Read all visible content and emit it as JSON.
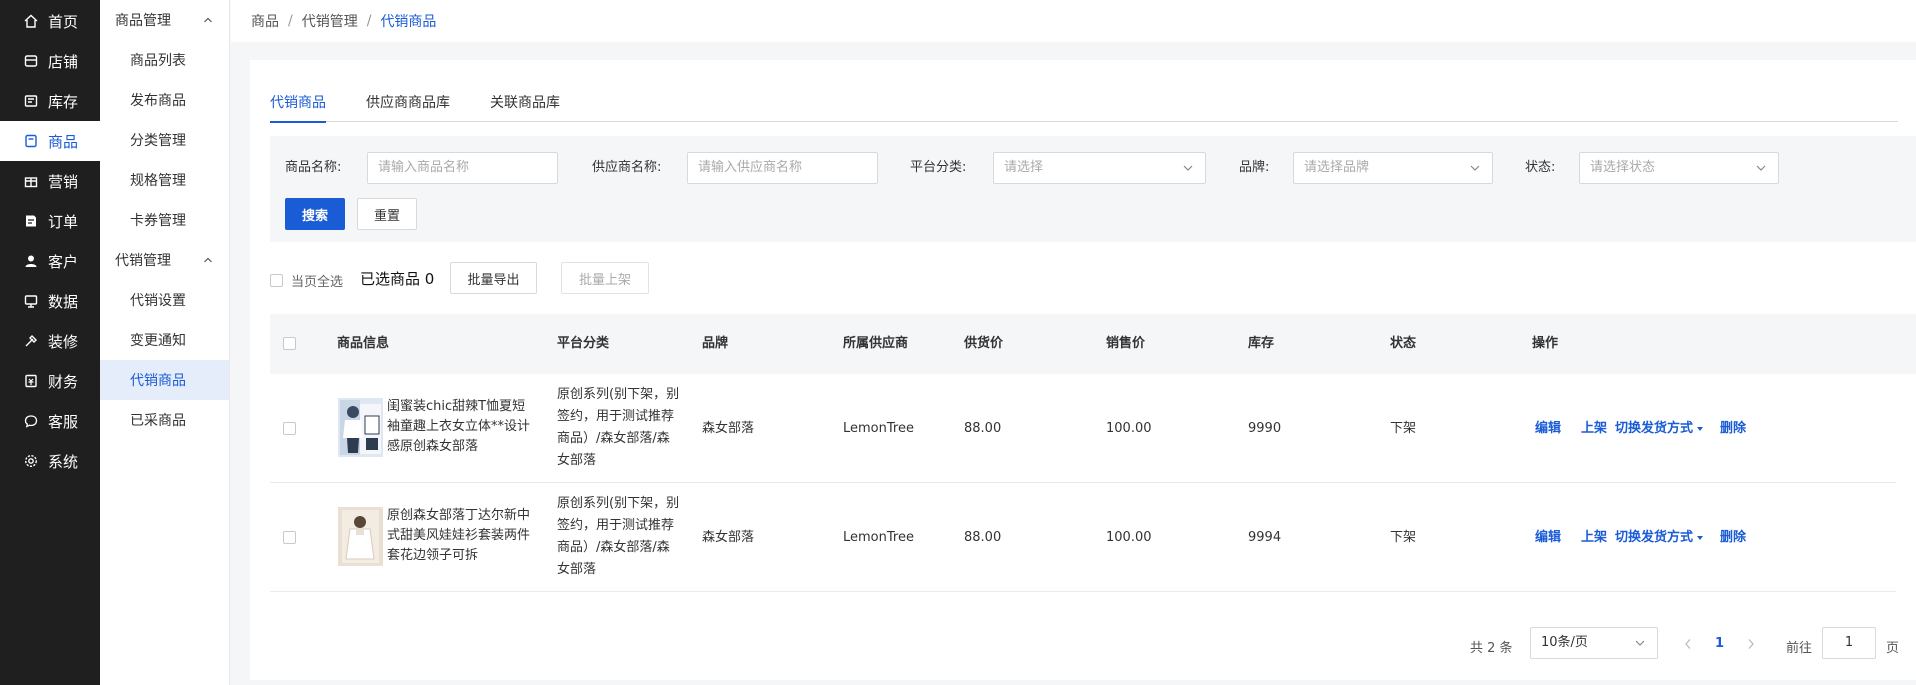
{
  "nav": {
    "items": [
      {
        "label": "首页",
        "icon": "home-icon"
      },
      {
        "label": "店铺",
        "icon": "store-icon"
      },
      {
        "label": "库存",
        "icon": "inventory-icon"
      },
      {
        "label": "商品",
        "icon": "goods-icon"
      },
      {
        "label": "营销",
        "icon": "gift-icon"
      },
      {
        "label": "订单",
        "icon": "order-icon"
      },
      {
        "label": "客户",
        "icon": "user-icon"
      },
      {
        "label": "数据",
        "icon": "data-icon"
      },
      {
        "label": "装修",
        "icon": "decorate-icon"
      },
      {
        "label": "财务",
        "icon": "finance-icon"
      },
      {
        "label": "客服",
        "icon": "chat-icon"
      },
      {
        "label": "系统",
        "icon": "gear-icon"
      }
    ]
  },
  "subnav": {
    "group1": "商品管理",
    "group1_items": [
      "商品列表",
      "发布商品",
      "分类管理",
      "规格管理",
      "卡券管理"
    ],
    "group2": "代销管理",
    "group2_items": [
      "代销设置",
      "变更通知",
      "代销商品",
      "已采商品"
    ]
  },
  "breadcrumb": [
    "商品",
    "代销管理",
    "代销商品"
  ],
  "tabs": [
    "代销商品",
    "供应商商品库",
    "关联商品库"
  ],
  "filter": {
    "name_label": "商品名称:",
    "name_placeholder": "请输入商品名称",
    "supplier_label": "供应商名称:",
    "supplier_placeholder": "请输入供应商名称",
    "category_label": "平台分类:",
    "category_placeholder": "请选择",
    "brand_label": "品牌:",
    "brand_placeholder": "请选择品牌",
    "status_label": "状态:",
    "status_placeholder": "请选择状态",
    "search": "搜索",
    "reset": "重置"
  },
  "bulk": {
    "select_page": "当页全选",
    "selected_label": "已选商品",
    "selected_count": "0",
    "export": "批量导出",
    "shelve": "批量上架"
  },
  "table": {
    "headers": [
      "商品信息",
      "平台分类",
      "品牌",
      "所属供应商",
      "供货价",
      "销售价",
      "库存",
      "状态",
      "操作"
    ],
    "rows": [
      {
        "name": "闺蜜装chic甜辣T恤夏短袖童趣上衣女立体**设计感原创森女部落",
        "category": "原创系列(别下架，别签约，用于测试推荐商品）/森女部落/森女部落",
        "brand": "森女部落",
        "supplier": "LemonTree",
        "supply_price": "88.00",
        "sale_price": "100.00",
        "stock": "9990",
        "status": "下架"
      },
      {
        "name": "原创森女部落丁达尔新中式甜美风娃娃衫套装两件套花边领子可拆",
        "category": "原创系列(别下架，别签约，用于测试推荐商品）/森女部落/森女部落",
        "brand": "森女部落",
        "supplier": "LemonTree",
        "supply_price": "88.00",
        "sale_price": "100.00",
        "stock": "9994",
        "status": "下架"
      }
    ],
    "actions": {
      "edit": "编辑",
      "shelve": "上架",
      "switch": "切换发货方式",
      "delete": "删除"
    }
  },
  "pagination": {
    "total": "共 2 条",
    "page_size": "10条/页",
    "current": "1",
    "goto_label": "前往",
    "goto_value": "1",
    "page_unit": "页"
  },
  "colors": {
    "accent": "#1a5bd6",
    "nav_bg": "#1f1f1f",
    "active_sub_bg": "#e5edfb"
  }
}
